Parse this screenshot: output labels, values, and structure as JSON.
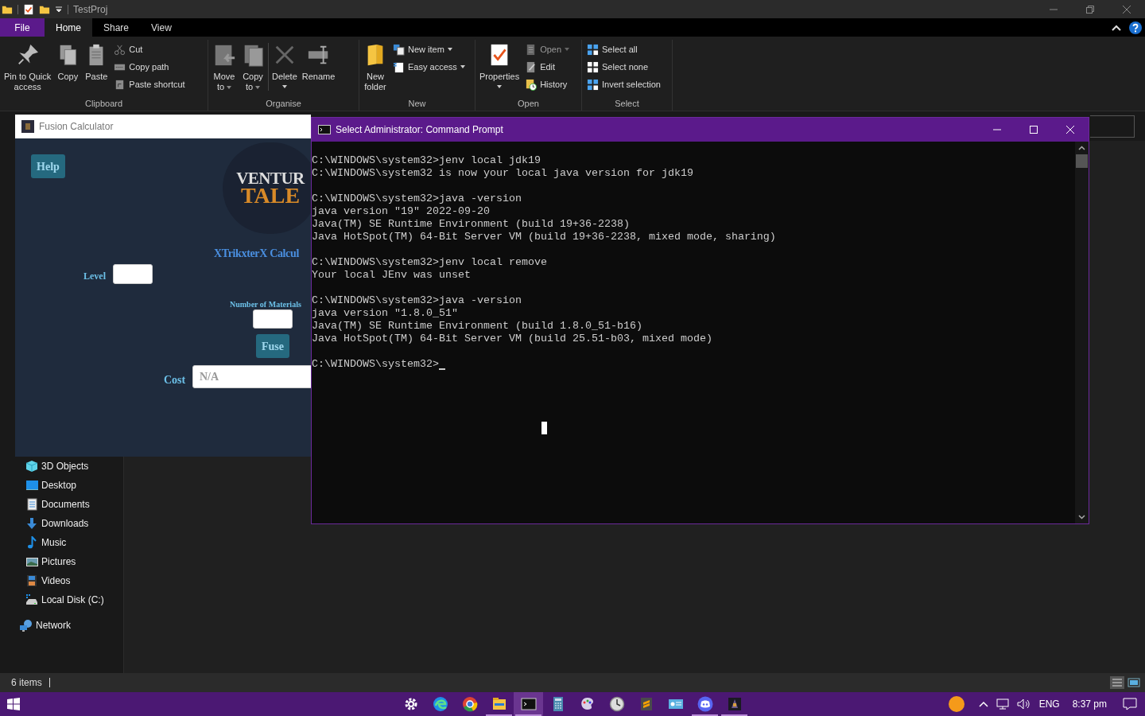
{
  "explorer": {
    "title": "TestProj",
    "tabs": [
      {
        "label": "File",
        "kind": "file",
        "selected": false
      },
      {
        "label": "Home",
        "kind": "tab",
        "selected": true
      },
      {
        "label": "Share",
        "kind": "tab",
        "selected": false
      },
      {
        "label": "View",
        "kind": "tab",
        "selected": false
      }
    ],
    "ribbon": [
      {
        "label": "Clipboard",
        "large": [
          {
            "lines": [
              "Pin to Quick",
              "access"
            ],
            "kind": "pin"
          },
          {
            "lines": [
              "Copy"
            ],
            "kind": "copy"
          },
          {
            "lines": [
              "Paste"
            ],
            "kind": "paste"
          }
        ],
        "small": [
          {
            "label": "Cut",
            "kind": "cut"
          },
          {
            "label": "Copy path",
            "kind": "path"
          },
          {
            "label": "Paste shortcut",
            "kind": "shortcut"
          }
        ]
      },
      {
        "label": "Organise",
        "large": [
          {
            "lines": [
              "Move",
              "to"
            ],
            "kind": "move",
            "dropdown": true
          },
          {
            "lines": [
              "Copy",
              "to"
            ],
            "kind": "copyto",
            "dropdown": true
          },
          {
            "lines": [
              "Delete"
            ],
            "kind": "delete",
            "dropdown": true
          },
          {
            "lines": [
              "Rename"
            ],
            "kind": "rename"
          }
        ]
      },
      {
        "label": "New",
        "large": [
          {
            "lines": [
              "New",
              "folder"
            ],
            "kind": "folder"
          }
        ],
        "small": [
          {
            "label": "New item",
            "kind": "newitem",
            "dropdown": true
          },
          {
            "label": "Easy access",
            "kind": "easy",
            "dropdown": true
          }
        ]
      },
      {
        "label": "Open",
        "large": [
          {
            "lines": [
              "Properties"
            ],
            "kind": "props",
            "dropdown": true
          }
        ],
        "small": [
          {
            "label": "Open",
            "kind": "open",
            "dropdown": true,
            "disabled": true
          },
          {
            "label": "Edit",
            "kind": "edit"
          },
          {
            "label": "History",
            "kind": "history"
          }
        ]
      },
      {
        "label": "Select",
        "small": [
          {
            "label": "Select all",
            "kind": "selall"
          },
          {
            "label": "Select none",
            "kind": "selnone"
          },
          {
            "label": "Invert selection",
            "kind": "selall"
          }
        ]
      }
    ],
    "this_pc_children": [
      {
        "label": "3D Objects",
        "kind": "cube"
      },
      {
        "label": "Desktop",
        "kind": "monitor"
      },
      {
        "label": "Documents",
        "kind": "doc"
      },
      {
        "label": "Downloads",
        "kind": "down"
      },
      {
        "label": "Music",
        "kind": "music"
      },
      {
        "label": "Pictures",
        "kind": "pic"
      },
      {
        "label": "Videos",
        "kind": "film"
      },
      {
        "label": "Local Disk (C:)",
        "kind": "drive"
      }
    ],
    "network": "Network",
    "status": "6 items"
  },
  "fusion": {
    "title": "Fusion Calculator",
    "help": "Help",
    "logo": [
      "VENTUR",
      "TALE"
    ],
    "heading": "XTrikxterX Calcul",
    "level_label": "Level",
    "materials_label": "Number of Materials",
    "fuse": "Fuse",
    "cost_label": "Cost",
    "cost_placeholder": "N/A"
  },
  "cmd": {
    "title": "Select Administrator: Command Prompt",
    "blocks": [
      [
        "C:\\WINDOWS\\system32>jenv local jdk19",
        "C:\\WINDOWS\\system32 is now your local java version for jdk19"
      ],
      [
        "C:\\WINDOWS\\system32>java -version",
        "java version \"19\" 2022-09-20",
        "Java(TM) SE Runtime Environment (build 19+36-2238)",
        "Java HotSpot(TM) 64-Bit Server VM (build 19+36-2238, mixed mode, sharing)"
      ],
      [
        "C:\\WINDOWS\\system32>jenv local remove",
        "Your local JEnv was unset"
      ],
      [
        "C:\\WINDOWS\\system32>java -version",
        "java version \"1.8.0_51\"",
        "Java(TM) SE Runtime Environment (build 1.8.0_51-b16)",
        "Java HotSpot(TM) 64-Bit Server VM (build 25.51-b03, mixed mode)"
      ]
    ],
    "prompt": "C:\\WINDOWS\\system32>"
  },
  "taskbar": {
    "apps": [
      {
        "kind": "gear",
        "running": false,
        "selected": false
      },
      {
        "kind": "edge",
        "running": false,
        "selected": false
      },
      {
        "kind": "chrome",
        "running": false,
        "selected": false
      },
      {
        "kind": "explorer",
        "running": true,
        "selected": false
      },
      {
        "kind": "cmd",
        "running": true,
        "selected": true
      },
      {
        "kind": "calc",
        "running": false,
        "selected": false
      },
      {
        "kind": "paint",
        "running": false,
        "selected": false
      },
      {
        "kind": "clock",
        "running": false,
        "selected": false
      },
      {
        "kind": "sublime",
        "running": false,
        "selected": false
      },
      {
        "kind": "card",
        "running": false,
        "selected": false
      },
      {
        "kind": "discord",
        "running": true,
        "selected": false
      },
      {
        "kind": "game",
        "running": true,
        "selected": false
      }
    ],
    "language": "ENG",
    "time": "8:37 pm"
  }
}
